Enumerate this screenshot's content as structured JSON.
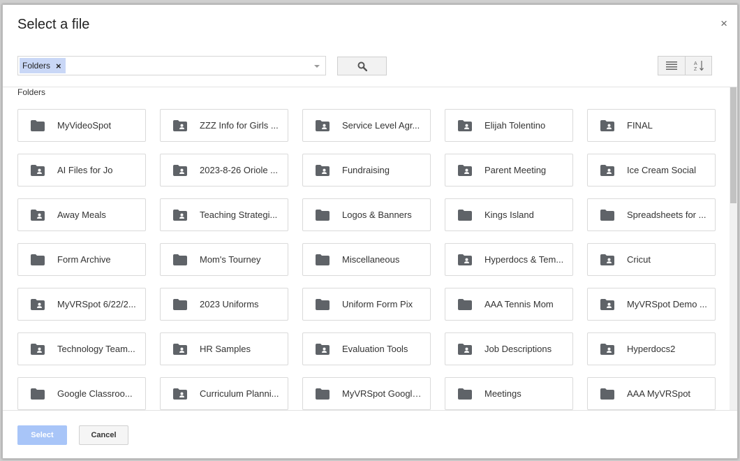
{
  "dialog": {
    "title": "Select a file",
    "close_label": "×"
  },
  "search": {
    "chip_label": "Folders",
    "chip_remove": "×",
    "search_button_icon": "search-icon"
  },
  "view_controls": {
    "list_view_icon": "list-view-icon",
    "sort_icon": "sort-az-icon"
  },
  "section": {
    "label": "Folders"
  },
  "folders": [
    {
      "name": "MyVideoSpot",
      "shared": false
    },
    {
      "name": "ZZZ Info for Girls ...",
      "shared": true
    },
    {
      "name": "Service Level Agr...",
      "shared": true
    },
    {
      "name": "Elijah Tolentino",
      "shared": true
    },
    {
      "name": "FINAL",
      "shared": true
    },
    {
      "name": "AI Files for Jo",
      "shared": true
    },
    {
      "name": "2023-8-26 Oriole ...",
      "shared": true
    },
    {
      "name": "Fundraising",
      "shared": true
    },
    {
      "name": "Parent Meeting",
      "shared": true
    },
    {
      "name": "Ice Cream Social",
      "shared": true
    },
    {
      "name": "Away Meals",
      "shared": true
    },
    {
      "name": "Teaching Strategi...",
      "shared": true
    },
    {
      "name": "Logos & Banners",
      "shared": false
    },
    {
      "name": "Kings Island",
      "shared": false
    },
    {
      "name": "Spreadsheets for ...",
      "shared": false
    },
    {
      "name": "Form Archive",
      "shared": false
    },
    {
      "name": "Mom's Tourney",
      "shared": false
    },
    {
      "name": "Miscellaneous",
      "shared": false
    },
    {
      "name": "Hyperdocs & Tem...",
      "shared": true
    },
    {
      "name": "Cricut",
      "shared": true
    },
    {
      "name": "MyVRSpot 6/22/2...",
      "shared": true
    },
    {
      "name": "2023 Uniforms",
      "shared": false
    },
    {
      "name": "Uniform Form Pix",
      "shared": false
    },
    {
      "name": "AAA Tennis Mom",
      "shared": false
    },
    {
      "name": "MyVRSpot Demo ...",
      "shared": true
    },
    {
      "name": "Technology Team...",
      "shared": true
    },
    {
      "name": "HR Samples",
      "shared": true
    },
    {
      "name": "Evaluation Tools",
      "shared": true
    },
    {
      "name": "Job Descriptions",
      "shared": true
    },
    {
      "name": "Hyperdocs2",
      "shared": true
    },
    {
      "name": "Google Classroo...",
      "shared": false
    },
    {
      "name": "Curriculum Planni...",
      "shared": true
    },
    {
      "name": "MyVRSpot Google...",
      "shared": false
    },
    {
      "name": "Meetings",
      "shared": false
    },
    {
      "name": "AAA MyVRSpot",
      "shared": false
    }
  ],
  "footer": {
    "select_label": "Select",
    "cancel_label": "Cancel"
  },
  "colors": {
    "chip_bg": "#c9d7f6",
    "select_button_disabled": "#a8c5f8",
    "folder_icon": "#5f6368"
  }
}
